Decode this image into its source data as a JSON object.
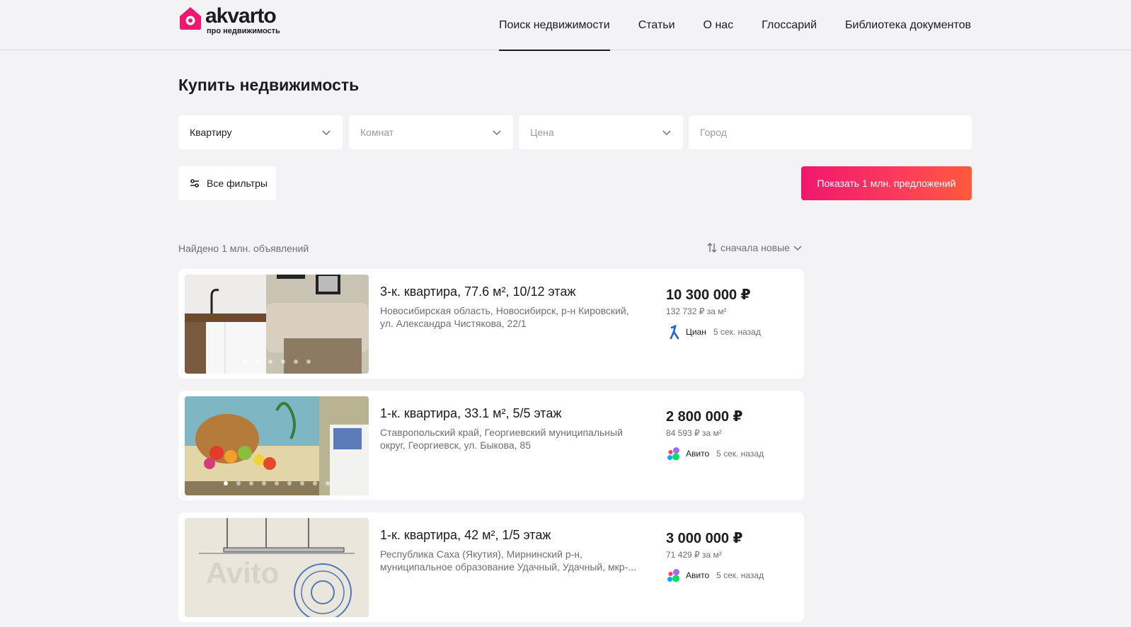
{
  "header": {
    "logo_word": "akvarto",
    "logo_sub": "про недвижимость",
    "nav": [
      {
        "label": "Поиск недвижимости",
        "active": true
      },
      {
        "label": "Статьи"
      },
      {
        "label": "О нас"
      },
      {
        "label": "Глоссарий"
      },
      {
        "label": "Библиотека документов"
      }
    ]
  },
  "page_title": "Купить недвижимость",
  "filters": {
    "type_value": "Квартиру",
    "rooms_placeholder": "Комнат",
    "price_placeholder": "Цена",
    "city_placeholder": "Город",
    "all_filters_label": "Все фильтры",
    "show_button_label": "Показать 1 млн. предложений"
  },
  "results": {
    "found_text": "Найдено 1 млн. объявлений",
    "sort_label": "сначала новые"
  },
  "listings": [
    {
      "title": "3-к. квартира, 77.6 м², 10/12 этаж",
      "address": "Новосибирская область, Новосибирск, р-н Кировский, ул. Александра Чистякова, 22/1",
      "price": "10 300 000 ₽",
      "price_per_m2": "132 732 ₽ за м²",
      "source": "Циан",
      "time": "5 сек. назад",
      "photo": "kitchen-sofa"
    },
    {
      "title": "1-к. квартира, 33.1 м², 5/5 этаж",
      "address": "Ставропольский край, Георгиевский муниципальный округ, Георгиевск, ул. Быкова, 85",
      "price": "2 800 000 ₽",
      "price_per_m2": "84 593 ₽ за м²",
      "source": "Авито",
      "time": "5 сек. назад",
      "photo": "fruit-painting"
    },
    {
      "title": "1-к. квартира, 42 м², 1/5 этаж",
      "address": "Республика Саха (Якутия), Мирнинский р-н, муниципальное образование Удачный, Удачный, мкр-...",
      "price": "3 000 000 ₽",
      "price_per_m2": "71 429 ₽ за м²",
      "source": "Авито",
      "time": "5 сек. назад",
      "photo": "floor-plan"
    }
  ],
  "colors": {
    "accent": "#f0176e",
    "background": "#f3f3f5",
    "cian_blue": "#1a5fe6"
  }
}
